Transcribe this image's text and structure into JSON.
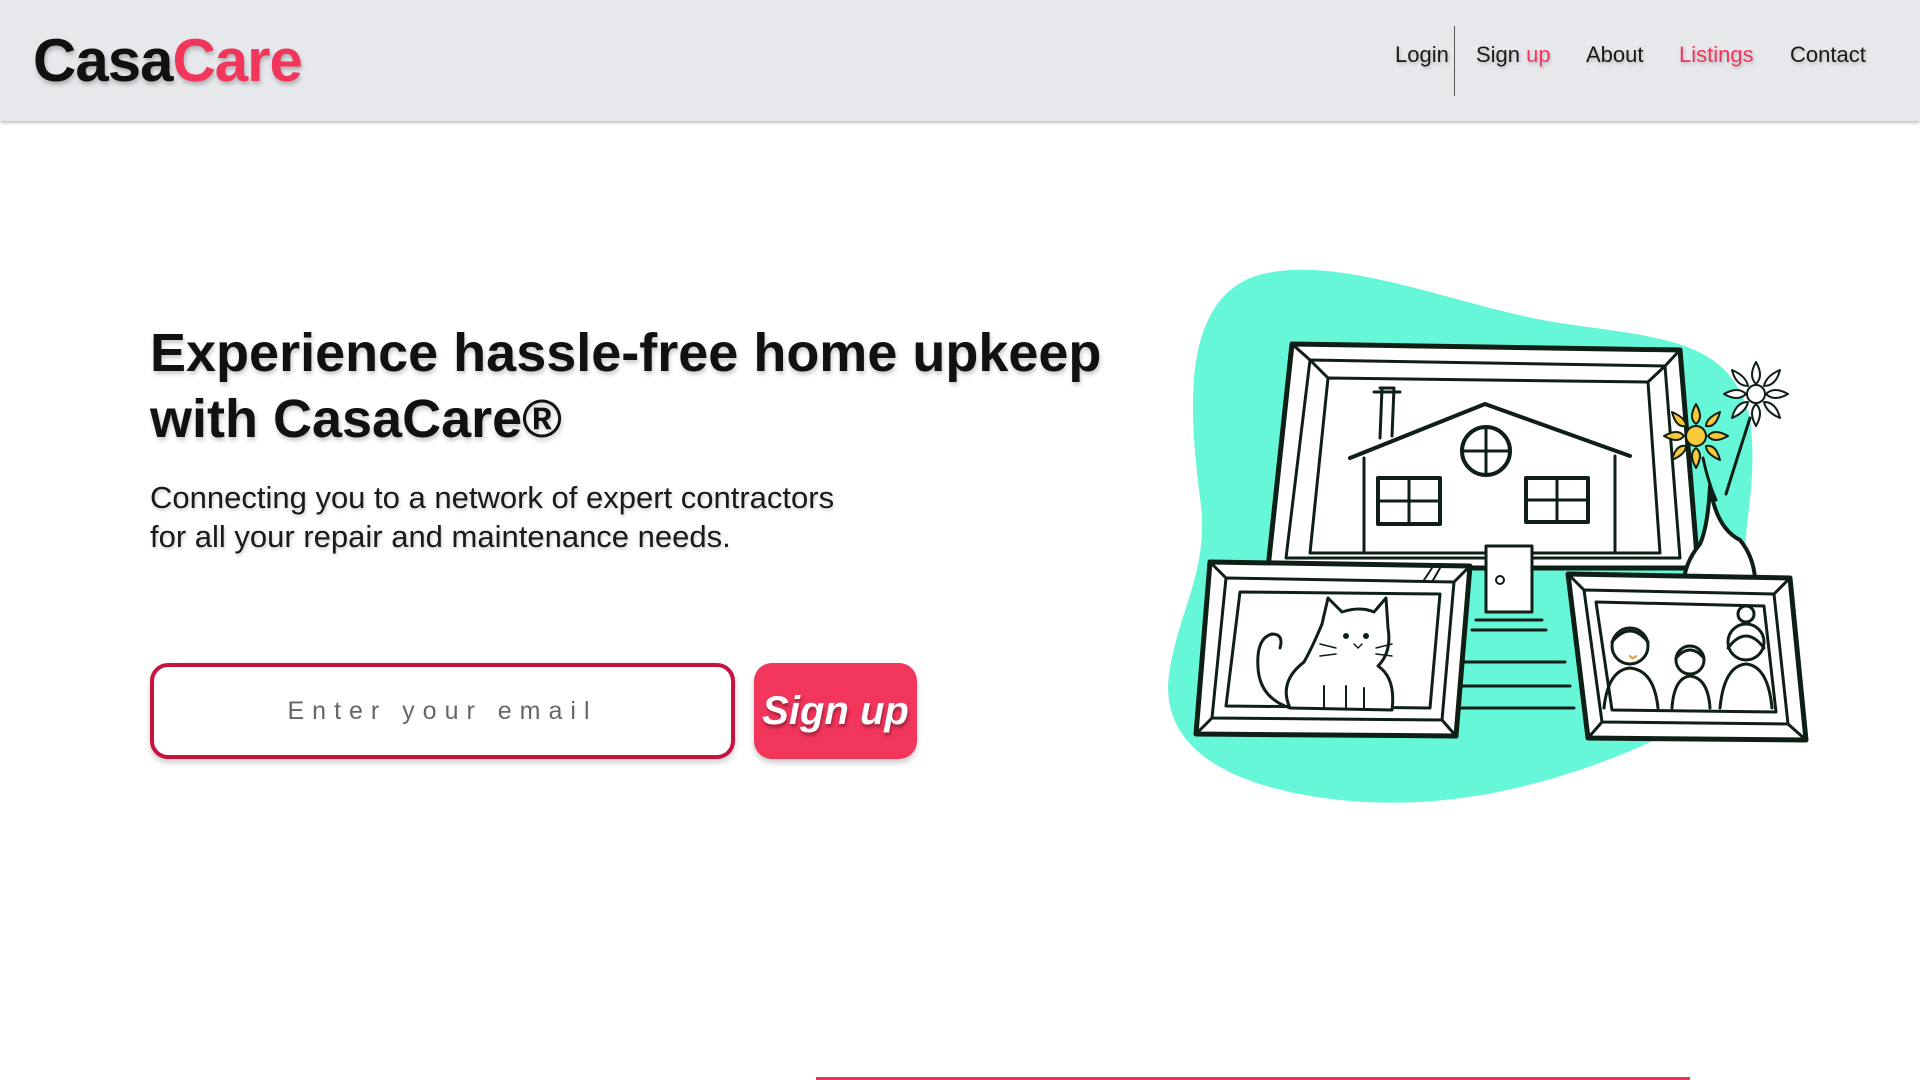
{
  "header": {
    "logo_part1": "Casa",
    "logo_part2": "Care",
    "nav": {
      "login": "Login",
      "signup_part1": "Sign",
      "signup_part2": "up",
      "about": "About",
      "listings": "Listings",
      "contact": "Contact"
    }
  },
  "hero": {
    "title_line1": "Experience hassle-free home upkeep",
    "title_line2": "with CasaCare®",
    "subtitle_line1": "Connecting you to a network of expert contractors",
    "subtitle_line2": "for all your repair and maintenance needs.",
    "email_placeholder": "Enter your email",
    "signup_label": "Sign up"
  },
  "colors": {
    "brand_accent": "#f2355b",
    "header_bg": "#e6e8ec",
    "illustration_blob": "#66f7d9",
    "input_border": "#c8123f"
  }
}
